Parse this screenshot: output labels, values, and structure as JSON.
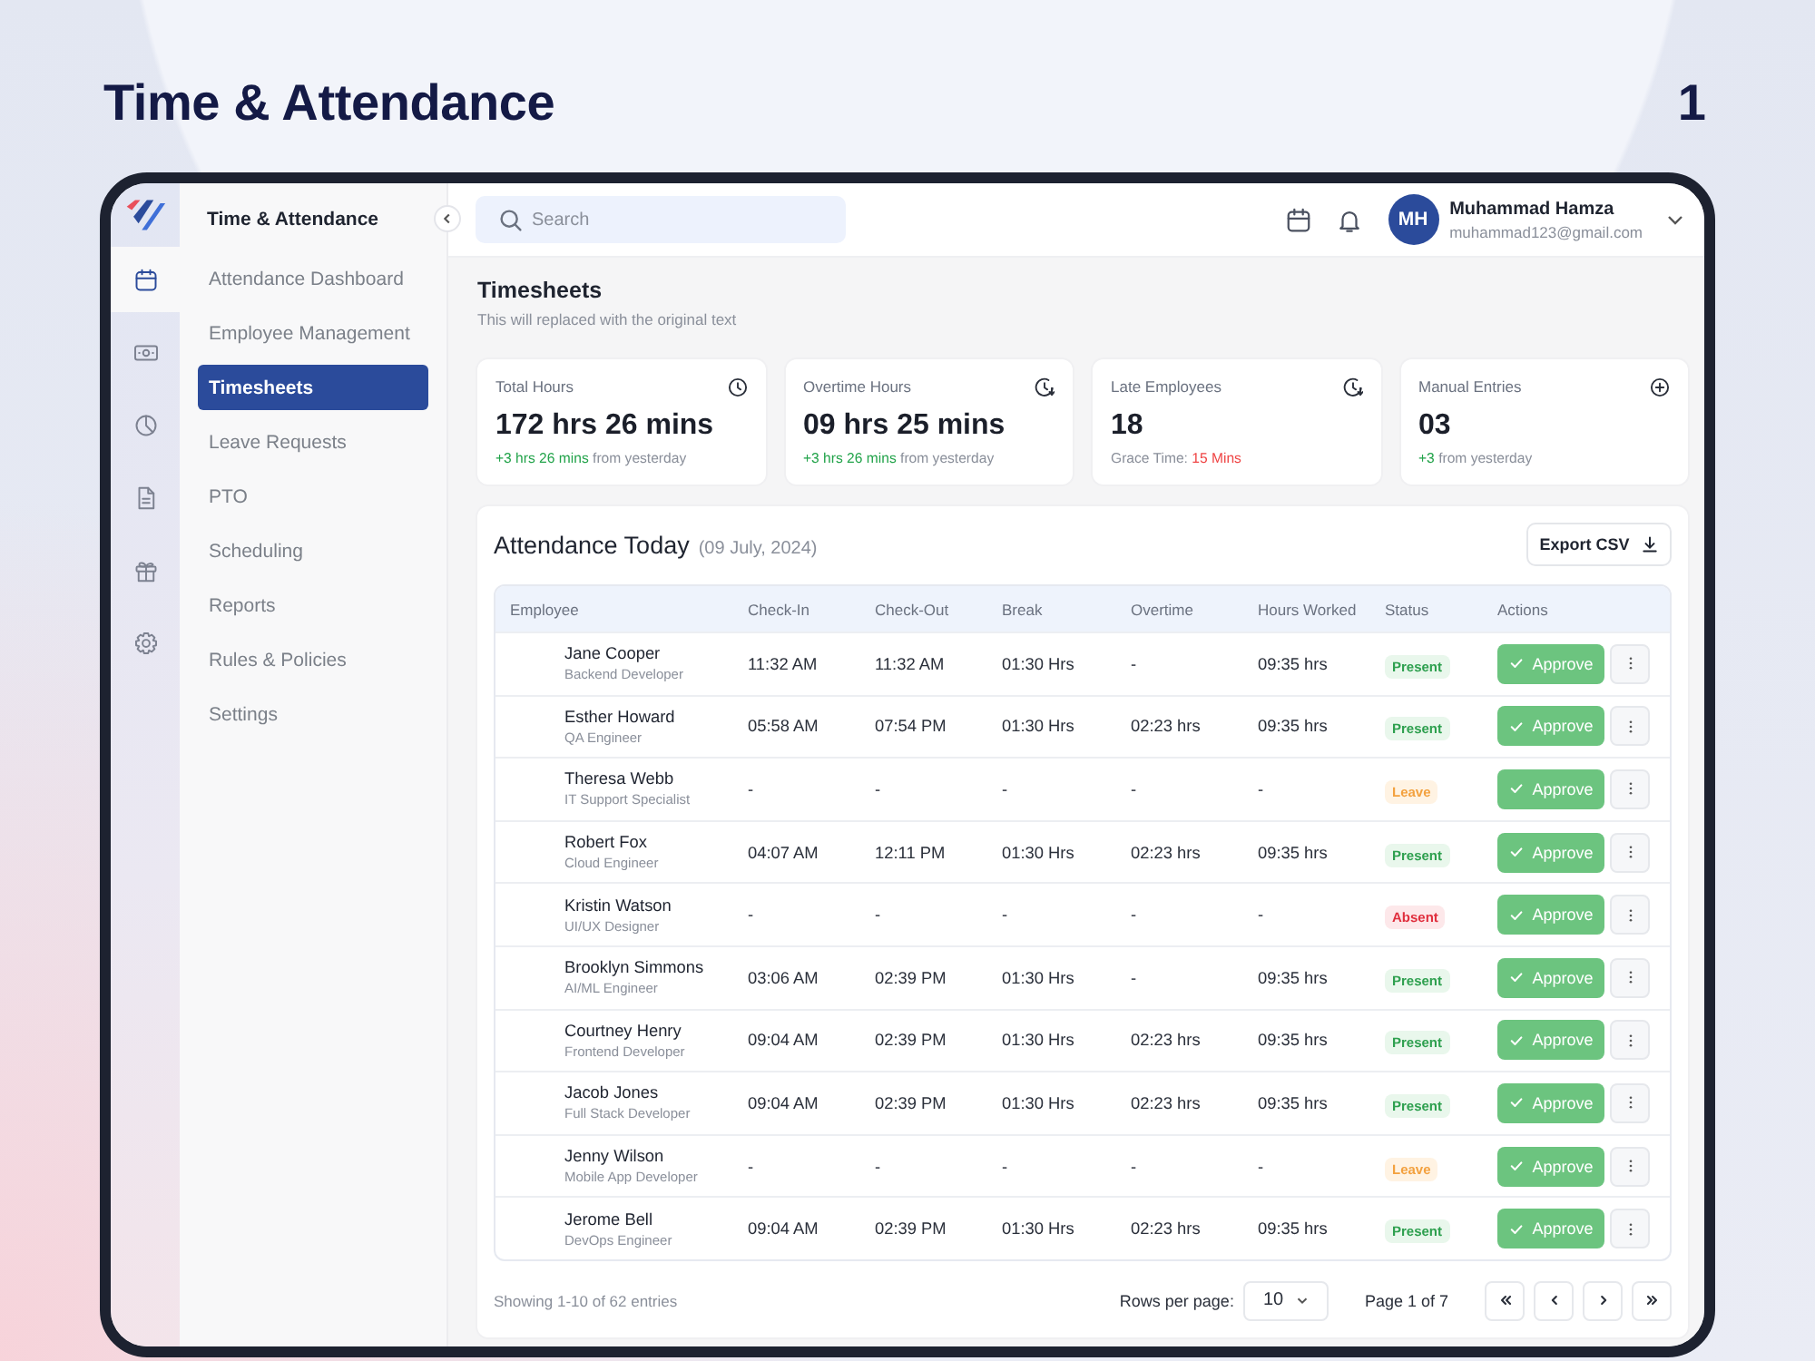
{
  "slide": {
    "title": "Time & Attendance",
    "page_number": "1"
  },
  "rail": {
    "items": [
      {
        "selected": true
      },
      {
        "selected": false
      },
      {
        "selected": false
      },
      {
        "selected": false
      },
      {
        "selected": false
      },
      {
        "selected": false
      }
    ]
  },
  "sidebar": {
    "title": "Time & Attendance",
    "items": [
      {
        "label": "Attendance Dashboard",
        "selected": false
      },
      {
        "label": "Employee Management",
        "selected": false
      },
      {
        "label": "Timesheets",
        "selected": true
      },
      {
        "label": "Leave Requests",
        "selected": false
      },
      {
        "label": "PTO",
        "selected": false
      },
      {
        "label": "Scheduling",
        "selected": false
      },
      {
        "label": "Reports",
        "selected": false
      },
      {
        "label": "Rules & Policies",
        "selected": false
      },
      {
        "label": "Settings",
        "selected": false
      }
    ]
  },
  "topbar": {
    "search": {
      "placeholder": "Search"
    },
    "user": {
      "initials": "MH",
      "name": "Muhammad Hamza",
      "email": "muhammad123@gmail.com"
    }
  },
  "page": {
    "title": "Timesheets",
    "subtitle": "This will replaced with the original text"
  },
  "cards": [
    {
      "label": "Total Hours",
      "value": "172 hrs 26 mins",
      "note": [
        {
          "text": "+3 hrs 26 mins",
          "kind": "positive"
        },
        {
          "text": "from yesterday",
          "kind": "muted"
        }
      ]
    },
    {
      "label": "Overtime Hours",
      "value": "09 hrs 25 mins",
      "note": [
        {
          "text": "+3 hrs 26 mins",
          "kind": "positive"
        },
        {
          "text": "from yesterday",
          "kind": "muted"
        }
      ]
    },
    {
      "label": "Late Employees",
      "value": "18",
      "note": [
        {
          "text": "Grace Time:",
          "kind": "muted"
        },
        {
          "text": "15 Mins",
          "kind": "negative"
        }
      ]
    },
    {
      "label": "Manual Entries",
      "value": "03",
      "note": [
        {
          "text": "+3",
          "kind": "positive"
        },
        {
          "text": "from yesterday",
          "kind": "muted"
        }
      ]
    }
  ],
  "attendance": {
    "title": "Attendance Today",
    "date": "(09 July, 2024)",
    "export_button": "Export CSV",
    "table": {
      "columns": [
        "Employee",
        "Check-In",
        "Check-Out",
        "Break",
        "Overtime",
        "Hours Worked",
        "Status",
        "Actions"
      ],
      "rows": [
        {
          "employee": {
            "name": "Jane Cooper",
            "role": "Backend Developer"
          },
          "check_in": "11:32 AM",
          "check_out": "11:32 AM",
          "break": "01:30 Hrs",
          "overtime": "-",
          "hours_worked": "09:35 hrs",
          "status": {
            "label": "Present",
            "kind": "present"
          },
          "action": "Approve"
        },
        {
          "employee": {
            "name": "Esther Howard",
            "role": "QA Engineer"
          },
          "check_in": "05:58 AM",
          "check_out": "07:54 PM",
          "break": "01:30 Hrs",
          "overtime": "02:23 hrs",
          "hours_worked": "09:35 hrs",
          "status": {
            "label": "Present",
            "kind": "present"
          },
          "action": "Approve"
        },
        {
          "employee": {
            "name": "Theresa Webb",
            "role": "IT Support Specialist"
          },
          "check_in": "-",
          "check_out": "-",
          "break": "-",
          "overtime": "-",
          "hours_worked": "-",
          "status": {
            "label": "Leave",
            "kind": "leave"
          },
          "action": "Approve"
        },
        {
          "employee": {
            "name": "Robert Fox",
            "role": "Cloud Engineer"
          },
          "check_in": "04:07 AM",
          "check_out": "12:11 PM",
          "break": "01:30 Hrs",
          "overtime": "02:23 hrs",
          "hours_worked": "09:35 hrs",
          "status": {
            "label": "Present",
            "kind": "present"
          },
          "action": "Approve"
        },
        {
          "employee": {
            "name": "Kristin Watson",
            "role": "UI/UX Designer"
          },
          "check_in": "-",
          "check_out": "-",
          "break": "-",
          "overtime": "-",
          "hours_worked": "-",
          "status": {
            "label": "Absent",
            "kind": "absent"
          },
          "action": "Approve"
        },
        {
          "employee": {
            "name": "Brooklyn Simmons",
            "role": "AI/ML Engineer"
          },
          "check_in": "03:06 AM",
          "check_out": "02:39 PM",
          "break": "01:30 Hrs",
          "overtime": "-",
          "hours_worked": "09:35 hrs",
          "status": {
            "label": "Present",
            "kind": "present"
          },
          "action": "Approve"
        },
        {
          "employee": {
            "name": "Courtney Henry",
            "role": "Frontend Developer"
          },
          "check_in": "09:04 AM",
          "check_out": "02:39 PM",
          "break": "01:30 Hrs",
          "overtime": "02:23 hrs",
          "hours_worked": "09:35 hrs",
          "status": {
            "label": "Present",
            "kind": "present"
          },
          "action": "Approve"
        },
        {
          "employee": {
            "name": "Jacob Jones",
            "role": "Full Stack Developer"
          },
          "check_in": "09:04 AM",
          "check_out": "02:39 PM",
          "break": "01:30 Hrs",
          "overtime": "02:23 hrs",
          "hours_worked": "09:35 hrs",
          "status": {
            "label": "Present",
            "kind": "present"
          },
          "action": "Approve"
        },
        {
          "employee": {
            "name": "Jenny Wilson",
            "role": "Mobile App Developer"
          },
          "check_in": "-",
          "check_out": "-",
          "break": "-",
          "overtime": "-",
          "hours_worked": "-",
          "status": {
            "label": "Leave",
            "kind": "leave"
          },
          "action": "Approve"
        },
        {
          "employee": {
            "name": "Jerome Bell",
            "role": "DevOps Engineer"
          },
          "check_in": "09:04 AM",
          "check_out": "02:39 PM",
          "break": "01:30 Hrs",
          "overtime": "02:23 hrs",
          "hours_worked": "09:35 hrs",
          "status": {
            "label": "Present",
            "kind": "present"
          },
          "action": "Approve"
        }
      ]
    },
    "footer": {
      "summary": "Showing 1-10 of 62 entries",
      "rows_per_page_label": "Rows per page:",
      "rows_per_page": "10",
      "page_label": "Page 1 of 7"
    }
  }
}
